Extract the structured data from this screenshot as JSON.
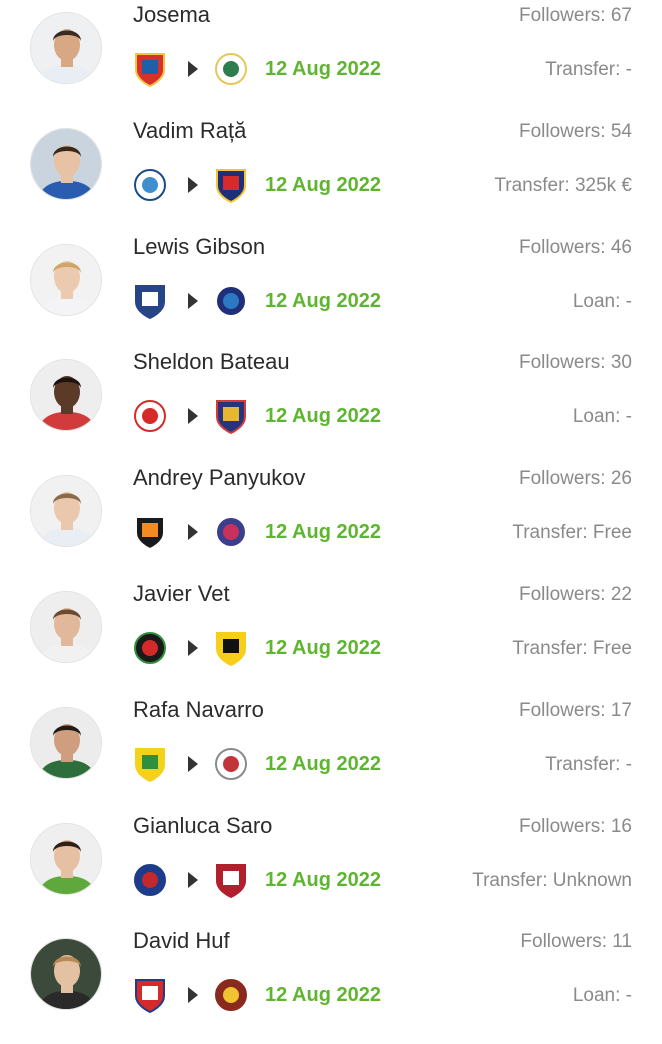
{
  "transfers": [
    {
      "name": "Josema",
      "followers": "Followers: 67",
      "date": "12 Aug 2022",
      "transfer": "Transfer: -",
      "from_colors": [
        "#d9302c",
        "#1e5fa8",
        "#f2c640"
      ],
      "to_colors": [
        "#ffffff",
        "#2e7d4f",
        "#e6c75a"
      ],
      "skin": "#d8a784",
      "hair": "#3a2c22",
      "shirt": "#e9eef5",
      "bg": "#eef0f2"
    },
    {
      "name": "Vadim Rață",
      "followers": "Followers: 54",
      "date": "12 Aug 2022",
      "transfer": "Transfer: 325k €",
      "from_colors": [
        "#ffffff",
        "#3f8fce",
        "#1b4b86"
      ],
      "to_colors": [
        "#1c2f7a",
        "#d52b2b",
        "#f3c531"
      ],
      "skin": "#e8c2a4",
      "hair": "#3a2a1e",
      "shirt": "#2a5db0",
      "bg": "#c9d4de"
    },
    {
      "name": "Lewis Gibson",
      "followers": "Followers: 46",
      "date": "12 Aug 2022",
      "transfer": "Loan: -",
      "from_colors": [
        "#274488",
        "#ffffff",
        "#274488"
      ],
      "to_colors": [
        "#1f2f7a",
        "#2b79c2",
        "#ffffff"
      ],
      "skin": "#eccab0",
      "hair": "#cfa56a",
      "shirt": "#f4f4f6",
      "bg": "#f2f2f2"
    },
    {
      "name": "Sheldon Bateau",
      "followers": "Followers: 30",
      "date": "12 Aug 2022",
      "transfer": "Loan: -",
      "from_colors": [
        "#ffffff",
        "#d42a2a",
        "#d42a2a"
      ],
      "to_colors": [
        "#24357e",
        "#e6b830",
        "#d43c3c"
      ],
      "skin": "#5b3a27",
      "hair": "#1d1410",
      "shirt": "#d23b3b",
      "bg": "#eeeeee"
    },
    {
      "name": "Andrey Panyukov",
      "followers": "Followers: 26",
      "date": "12 Aug 2022",
      "transfer": "Transfer: Free",
      "from_colors": [
        "#1a1a1a",
        "#f28b22",
        "#ffffff"
      ],
      "to_colors": [
        "#3b3e8c",
        "#c8325a",
        "#ffffff"
      ],
      "skin": "#e9c8ad",
      "hair": "#8a6a48",
      "shirt": "#e8eef4",
      "bg": "#f1f1f1"
    },
    {
      "name": "Javier Vet",
      "followers": "Followers: 22",
      "date": "12 Aug 2022",
      "transfer": "Transfer: Free",
      "from_colors": [
        "#1a1a1a",
        "#d62a2a",
        "#2f8f3c"
      ],
      "to_colors": [
        "#f6cf1a",
        "#111111",
        "#f6cf1a"
      ],
      "skin": "#e1b89a",
      "hair": "#6a4a30",
      "shirt": "#f1f1f1",
      "bg": "#eeeeee"
    },
    {
      "name": "Rafa Navarro",
      "followers": "Followers: 17",
      "date": "12 Aug 2022",
      "transfer": "Transfer: -",
      "from_colors": [
        "#f4d21c",
        "#2f8f3c",
        "#f4d21c"
      ],
      "to_colors": [
        "#ffffff",
        "#c3343a",
        "#8a8a8a"
      ],
      "skin": "#cf9e7e",
      "hair": "#231a14",
      "shirt": "#2d6e3c",
      "bg": "#ececec"
    },
    {
      "name": "Gianluca Saro",
      "followers": "Followers: 16",
      "date": "12 Aug 2022",
      "transfer": "Transfer: Unknown",
      "from_colors": [
        "#1f3c8a",
        "#c2282c",
        "#1f3c8a"
      ],
      "to_colors": [
        "#b21f2d",
        "#ffffff",
        "#b21f2d"
      ],
      "skin": "#e6c0a2",
      "hair": "#2e2018",
      "shirt": "#5fa83c",
      "bg": "#efefef"
    },
    {
      "name": "David Huf",
      "followers": "Followers: 11",
      "date": "12 Aug 2022",
      "transfer": "Loan: -",
      "from_colors": [
        "#d62a2a",
        "#ffffff",
        "#1f3c8a"
      ],
      "to_colors": [
        "#8a2a1e",
        "#f1c232",
        "#8a2a1e"
      ],
      "skin": "#e5c1a3",
      "hair": "#b58a55",
      "shirt": "#2a2a2a",
      "bg": "#3b4a3a"
    }
  ]
}
